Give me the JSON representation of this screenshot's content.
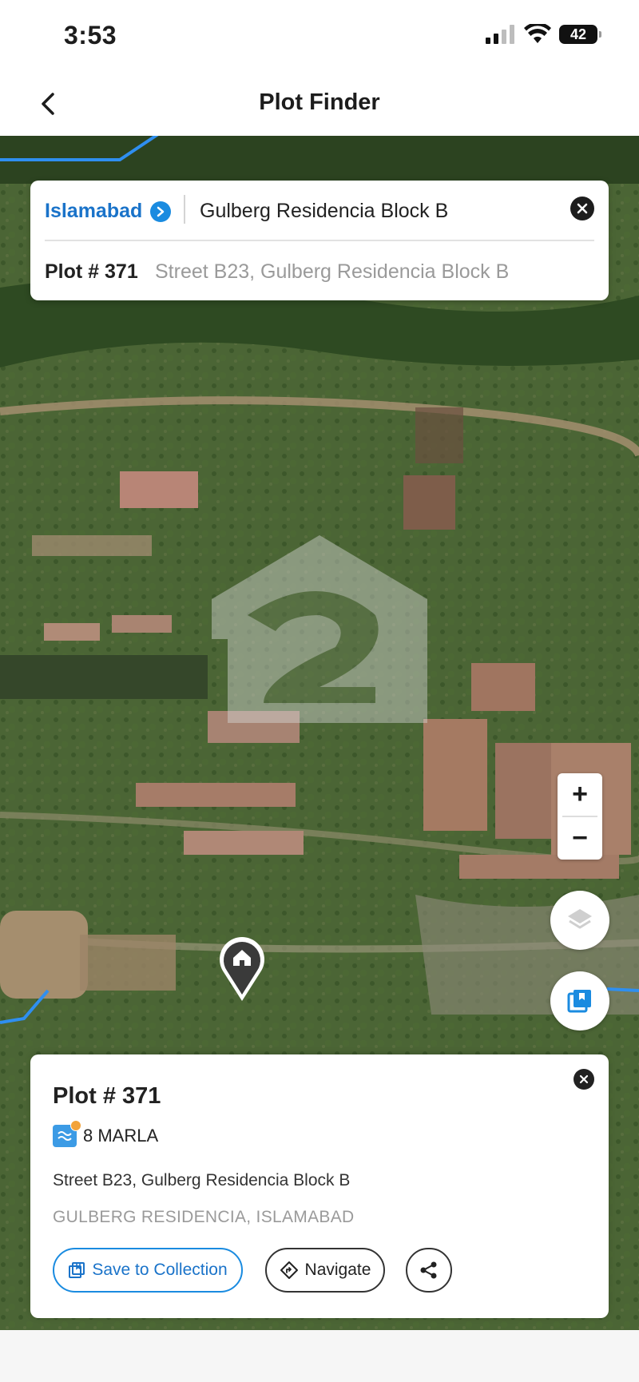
{
  "status_bar": {
    "time": "3:53",
    "battery": "42"
  },
  "header": {
    "title": "Plot Finder"
  },
  "search": {
    "city": "Islamabad",
    "query": "Gulberg Residencia Block B",
    "result_plot": "Plot # 371",
    "result_address": "Street B23, Gulberg Residencia Block B"
  },
  "map_controls": {
    "zoom_in": "+",
    "zoom_out": "−"
  },
  "plot_details": {
    "title": "Plot # 371",
    "size": "8 MARLA",
    "street": "Street B23, Gulberg Residencia Block B",
    "area": "GULBERG RESIDENCIA, ISLAMABAD",
    "save_label": "Save to Collection",
    "navigate_label": "Navigate"
  },
  "colors": {
    "accent": "#1a8be0",
    "map_boundary": "#2f8ff0"
  }
}
